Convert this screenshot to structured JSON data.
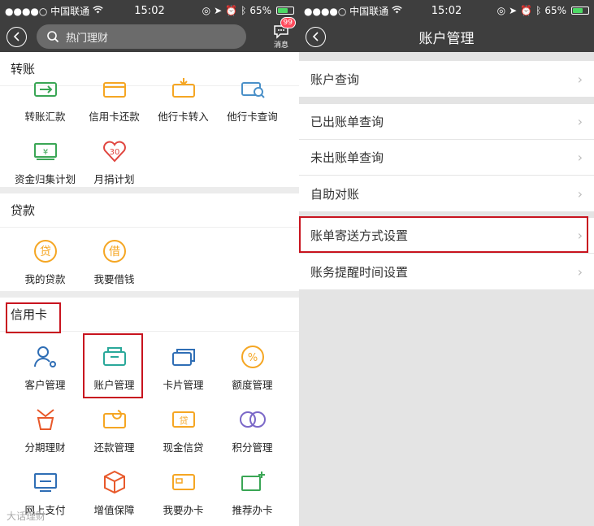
{
  "status": {
    "carrier": "●●●●○ 中国联通",
    "time": "15:02",
    "battery": "65%"
  },
  "left": {
    "search_placeholder": "热门理财",
    "message_label": "消息",
    "message_badge": "99",
    "sections": [
      {
        "title": "转账",
        "items": [
          {
            "label": "转账汇款",
            "icon": "transfer-icon",
            "color": "#3aa655"
          },
          {
            "label": "信用卡还款",
            "icon": "card-repay-icon",
            "color": "#f5a623"
          },
          {
            "label": "他行卡转入",
            "icon": "card-in-icon",
            "color": "#f5a623"
          },
          {
            "label": "他行卡查询",
            "icon": "card-search-icon",
            "color": "#4a90c8"
          },
          {
            "label": "资金归集计划",
            "icon": "money-collect-icon",
            "color": "#3aa655"
          },
          {
            "label": "月捐计划",
            "icon": "heart-30-icon",
            "color": "#e0453f"
          }
        ]
      },
      {
        "title": "贷款",
        "items": [
          {
            "label": "我的贷款",
            "icon": "loan-icon",
            "glyph": "贷",
            "color": "#f5a623"
          },
          {
            "label": "我要借钱",
            "icon": "borrow-icon",
            "glyph": "借",
            "color": "#f5a623"
          }
        ]
      },
      {
        "title": "信用卡",
        "items": [
          {
            "label": "客户管理",
            "icon": "customer-icon",
            "color": "#2f6eb5"
          },
          {
            "label": "账户管理",
            "icon": "account-icon",
            "color": "#2aa89a"
          },
          {
            "label": "卡片管理",
            "icon": "cards-icon",
            "color": "#2f6eb5"
          },
          {
            "label": "额度管理",
            "icon": "percent-icon",
            "color": "#f5a623"
          },
          {
            "label": "分期理财",
            "icon": "installment-icon",
            "color": "#e8592b"
          },
          {
            "label": "还款管理",
            "icon": "repay-icon",
            "color": "#f5a623"
          },
          {
            "label": "现金信贷",
            "icon": "cash-loan-icon",
            "glyph": "贷",
            "color": "#f5a623"
          },
          {
            "label": "积分管理",
            "icon": "points-icon",
            "color": "#7b68c8"
          },
          {
            "label": "网上支付",
            "icon": "online-pay-icon",
            "color": "#2f6eb5"
          },
          {
            "label": "增值保障",
            "icon": "box-icon",
            "color": "#e8592b"
          },
          {
            "label": "我要办卡",
            "icon": "apply-card-icon",
            "color": "#f5a623"
          },
          {
            "label": "推荐办卡",
            "icon": "recommend-card-icon",
            "color": "#3aa655"
          }
        ]
      }
    ]
  },
  "right": {
    "title": "账户管理",
    "groups": [
      [
        "账户查询"
      ],
      [
        "已出账单查询",
        "未出账单查询",
        "自助对账"
      ],
      [
        "账单寄送方式设置",
        "账务提醒时间设置"
      ]
    ]
  },
  "watermark": "大话理财"
}
